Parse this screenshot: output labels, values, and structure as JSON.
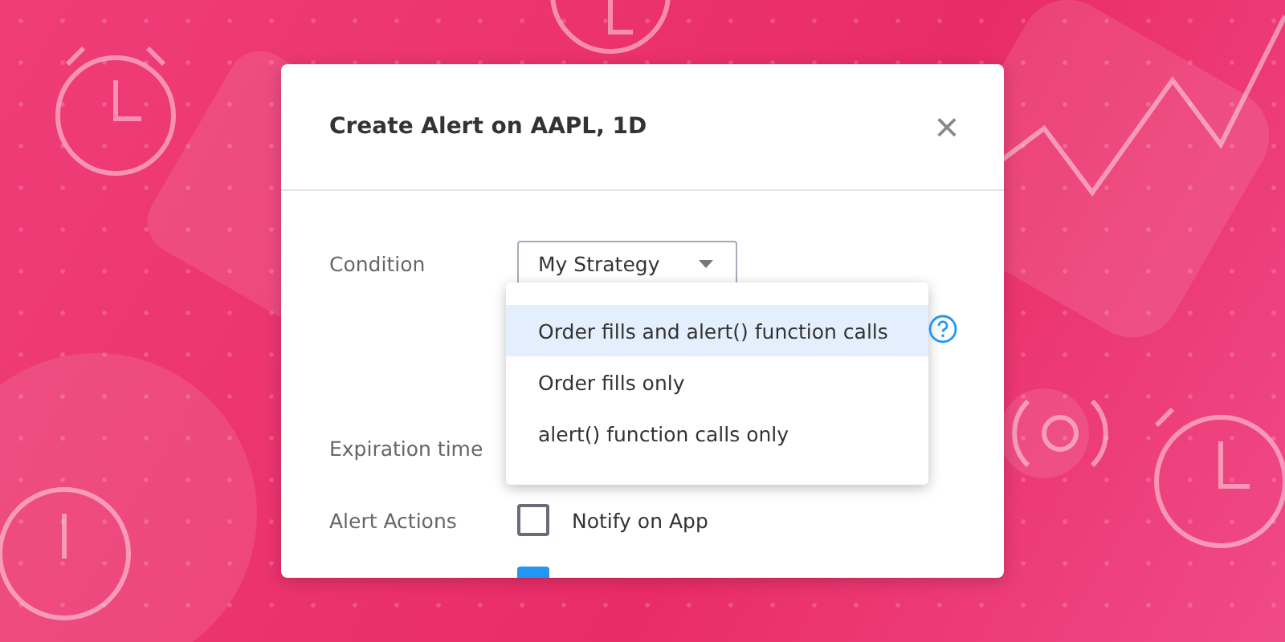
{
  "dialog": {
    "title": "Create Alert on AAPL, 1D",
    "close": "×"
  },
  "fields": [
    {
      "label": "Condition"
    },
    {
      "label": "Expiration time"
    },
    {
      "label": "Alert Actions"
    }
  ],
  "condition_select": {
    "value": "My Strategy",
    "expanded": true
  },
  "dropdown": {
    "options": [
      {
        "label": "Order fills and alert() function calls",
        "selected": true
      },
      {
        "label": "Order fills only",
        "selected": false
      },
      {
        "label": "alert() function calls only",
        "selected": false
      }
    ]
  },
  "actions": [
    {
      "label": "Notify on App",
      "checked": false
    },
    {
      "checked": true
    }
  ]
}
